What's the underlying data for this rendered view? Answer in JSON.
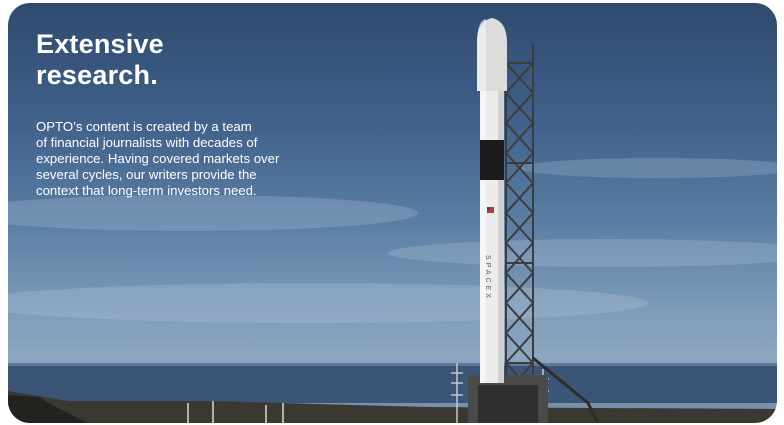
{
  "hero": {
    "title_line1": "Extensive",
    "title_line2": "research.",
    "body_lines": [
      "OPTO’s content is created by a team",
      "of financial journalists with decades of",
      "experience. Having covered markets over",
      "several cycles, our writers provide the",
      "context that long-term investors need."
    ],
    "rocket_text": "SPACEX"
  },
  "colors": {
    "sky_top": "#2f4a6e",
    "ocean": "#3a5576",
    "text": "#ffffff"
  }
}
